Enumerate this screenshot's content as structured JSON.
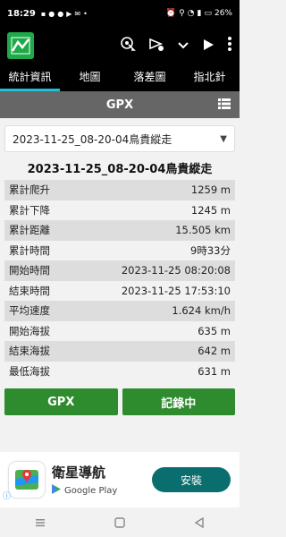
{
  "status": {
    "time": "18:29",
    "battery": "26%"
  },
  "tabs": [
    {
      "label": "統計資訊",
      "active": true
    },
    {
      "label": "地圖",
      "active": false
    },
    {
      "label": "落差圖",
      "active": false
    },
    {
      "label": "指北針",
      "active": false
    }
  ],
  "header": {
    "title": "GPX"
  },
  "selector": {
    "value": "2023-11-25_08-20-04鳥貴縱走"
  },
  "track_title": "2023-11-25_08-20-04鳥貴縱走",
  "stats": [
    {
      "label": "累計爬升",
      "value": "1259 m"
    },
    {
      "label": "累計下降",
      "value": "1245 m"
    },
    {
      "label": "累計距離",
      "value": "15.505 km"
    },
    {
      "label": "累計時間",
      "value": "9時33分"
    },
    {
      "label": "開始時間",
      "value": "2023-11-25 08:20:08"
    },
    {
      "label": "結束時間",
      "value": "2023-11-25 17:53:10"
    },
    {
      "label": "平均速度",
      "value": "1.624 km/h"
    },
    {
      "label": "開始海拔",
      "value": "635 m"
    },
    {
      "label": "結束海拔",
      "value": "642 m"
    },
    {
      "label": "最低海拔",
      "value": "631 m"
    }
  ],
  "buttons": {
    "gpx": "GPX",
    "recording": "記錄中"
  },
  "ad": {
    "app_name": "衛星導航",
    "store": "Google Play",
    "install": "安裝"
  }
}
